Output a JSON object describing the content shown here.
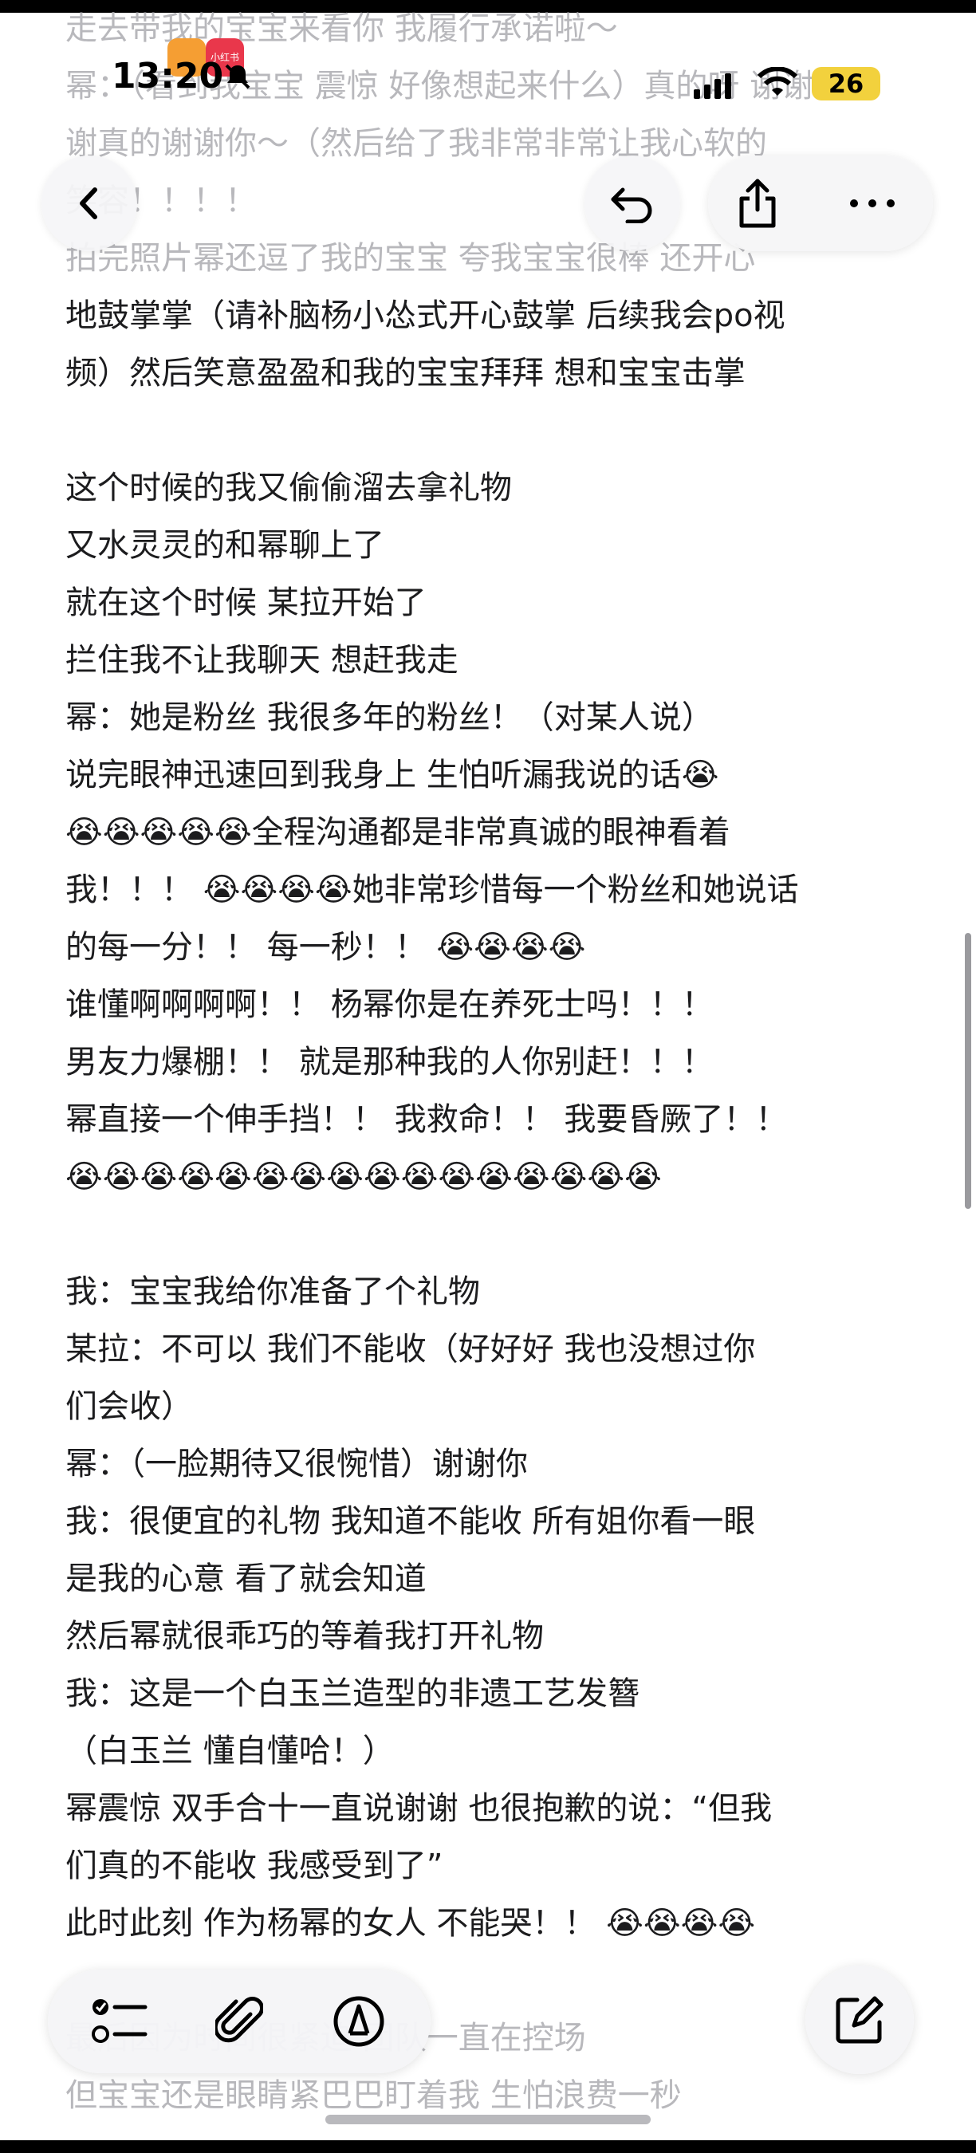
{
  "status_bar": {
    "time": "13:20",
    "battery": "26",
    "app_badge_label": "小红书"
  },
  "note": {
    "lines": [
      "走去带我的宝宝来看你 我履行承诺啦～",
      "幂：（看到我宝宝 震惊 好像想起来什么）真的呀 谢谢谢",
      "谢真的谢谢你～（然后给了我非常非常让我心软的",
      "笑容！！！！",
      "拍完照片幂还逗了我的宝宝 夸我宝宝很棒 还开心",
      "地鼓掌掌（请补脑杨小怂式开心鼓掌 后续我会po视",
      "频）然后笑意盈盈和我的宝宝拜拜 想和宝宝击掌",
      "",
      "这个时候的我又偷偷溜去拿礼物",
      "又水灵灵的和幂聊上了",
      "就在这个时候 某拉开始了",
      "拦住我不让我聊天 想赶我走",
      "幂：她是粉丝 我很多年的粉丝！（对某人说）",
      "说完眼神迅速回到我身上 生怕听漏我说的话😭",
      "😭😭😭😭😭全程沟通都是非常真诚的眼神看着",
      "我！！！ 😭😭😭😭她非常珍惜每一个粉丝和她说话",
      "的每一分！！ 每一秒！！ 😭😭😭😭",
      "谁懂啊啊啊啊！！ 杨幂你是在养死士吗！！！",
      "男友力爆棚！！ 就是那种我的人你别赶！！！",
      "幂直接一个伸手挡！！ 我救命！！ 我要昏厥了！！",
      "😭😭😭😭😭😭😭😭😭😭😭😭😭😭😭😭",
      "",
      "我：宝宝我给你准备了个礼物",
      "某拉：不可以 我们不能收（好好好 我也没想过你",
      "们会收）",
      "幂：（一脸期待又很惋惜）谢谢你",
      "我：很便宜的礼物 我知道不能收 所有姐你看一眼",
      "是我的心意 看了就会知道",
      "然后幂就很乖巧的等着我打开礼物",
      "我：这是一个白玉兰造型的非遗工艺发簪",
      "（白玉兰 懂自懂哈！）",
      "幂震惊 双手合十一直说谢谢 也很抱歉的说：“但我",
      "们真的不能收 我感受到了”",
      " 此时此刻 作为杨幂的女人 不能哭！！ 😭😭😭😭",
      "",
      "最后因为时间很紧迫 团队一直在控场",
      "但宝宝还是眼睛紧巴巴盯着我 生怕浪费一秒"
    ]
  },
  "icons": {
    "back": "chevron-left-icon",
    "undo": "undo-icon",
    "share": "share-icon",
    "more": "more-icon",
    "checklist": "checklist-icon",
    "attach": "paperclip-icon",
    "markup": "pen-markup-icon",
    "compose": "compose-icon"
  },
  "colors": {
    "badge_orange": "#f59e33",
    "badge_red": "#e9374b",
    "battery_yellow": "#f2d13d"
  }
}
